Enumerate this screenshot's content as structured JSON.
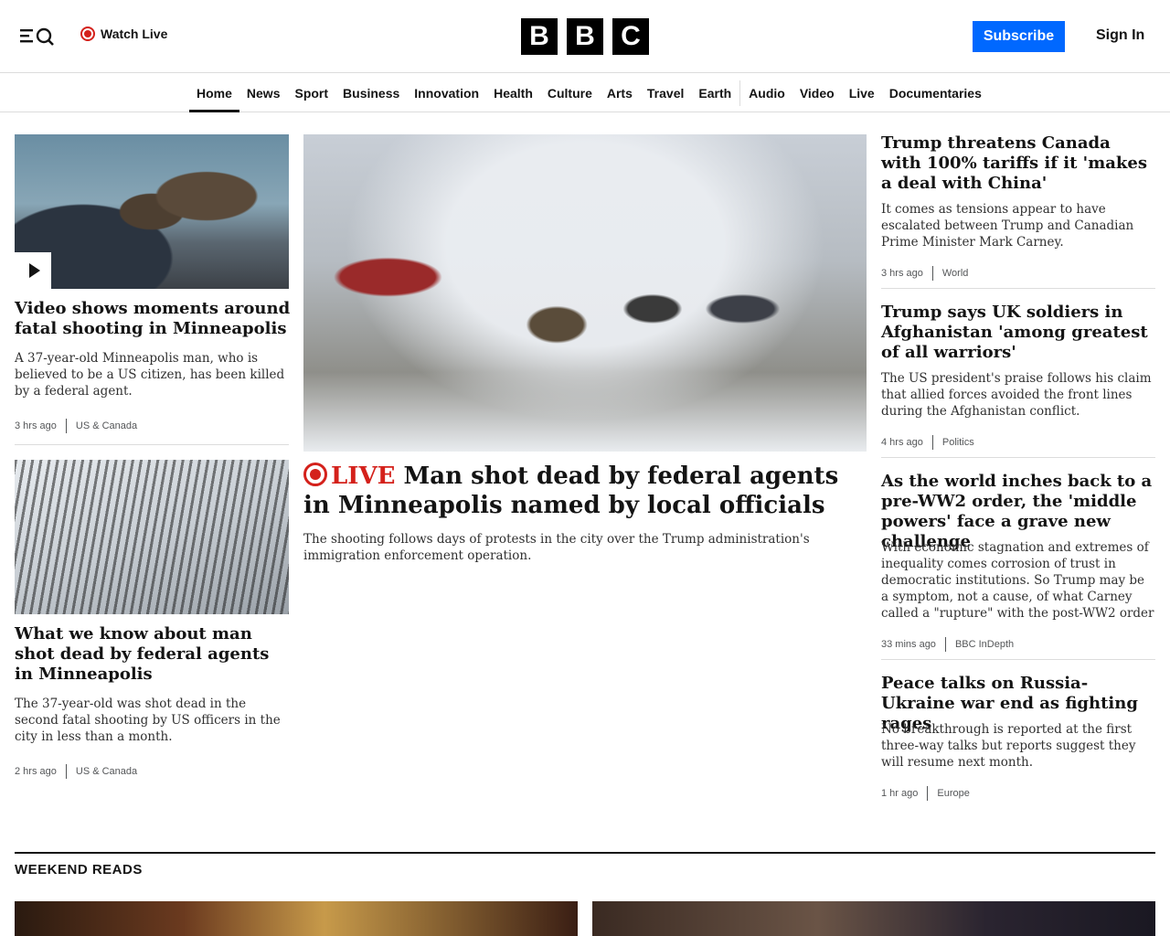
{
  "header": {
    "watch_live": "Watch Live",
    "logo_letters": [
      "B",
      "B",
      "C"
    ],
    "subscribe": "Subscribe",
    "sign_in": "Sign In"
  },
  "nav": [
    "Home",
    "News",
    "Sport",
    "Business",
    "Innovation",
    "Health",
    "Culture",
    "Arts",
    "Travel",
    "Earth",
    "Audio",
    "Video",
    "Live",
    "Documentaries"
  ],
  "stories": {
    "left1": {
      "headline": "Video shows moments around fatal shooting in Minneapolis",
      "summary": "A 37-year-old Minneapolis man, who is believed to be a US citizen, has been killed by a federal agent.",
      "time": "3 hrs ago",
      "section": "US & Canada"
    },
    "left2": {
      "headline": "What we know about man shot dead by federal agents in Minneapolis",
      "summary": "The 37-year-old was shot dead in the second fatal shooting by US officers in the city in less than a month.",
      "time": "2 hrs ago",
      "section": "US & Canada"
    },
    "lead": {
      "live": "LIVE",
      "headline": "Man shot dead by federal agents in Minneapolis named by local officials",
      "summary": "The shooting follows days of protests in the city over the Trump administration's immigration enforcement operation."
    },
    "right1": {
      "headline": "Trump threatens Canada with 100% tariffs if it 'makes a deal with China'",
      "summary": "It comes as tensions appear to have escalated between Trump and Canadian Prime Minister Mark Carney.",
      "time": "3 hrs ago",
      "section": "World"
    },
    "right2": {
      "headline": "Trump says UK soldiers in Afghanistan 'among greatest of all warriors'",
      "summary": "The US president's praise follows his claim that allied forces avoided the front lines during the Afghanistan conflict.",
      "time": "4 hrs ago",
      "section": "Politics"
    },
    "right3": {
      "headline": "As the world inches back to a pre-WW2 order, the 'middle powers' face a grave new challenge",
      "summary": "With economic stagnation and extremes of inequality comes corrosion of trust in democratic institutions. So Trump may be a symptom, not a cause, of what Carney called a \"rupture\" with the post-WW2 order",
      "time": "33 mins ago",
      "section": "BBC InDepth"
    },
    "right4": {
      "headline": "Peace talks on Russia-Ukraine war end as fighting rages",
      "summary": "No breakthrough is reported at the first three-way talks but reports suggest they will resume next month.",
      "time": "1 hr ago",
      "section": "Europe"
    }
  },
  "sections": {
    "weekend_reads": "WEEKEND READS"
  }
}
